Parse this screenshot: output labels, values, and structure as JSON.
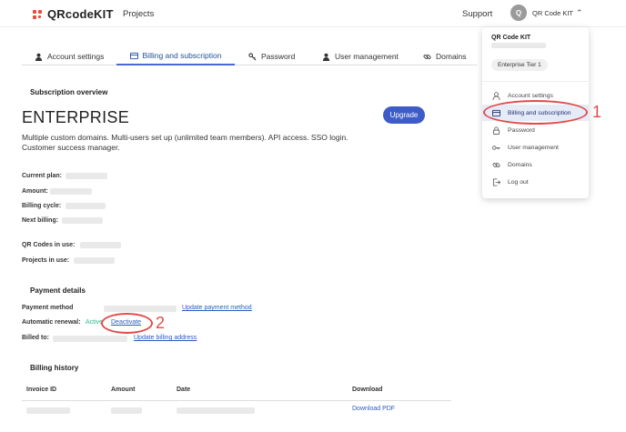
{
  "topbar": {
    "logo_text": "QRcodeKIT",
    "projects": "Projects",
    "support": "Support",
    "avatar_letter": "Q",
    "account_name": "QR Code KIT"
  },
  "tabs": [
    {
      "label": "Account settings",
      "icon": "user-icon"
    },
    {
      "label": "Billing and subscription",
      "icon": "card-icon",
      "active": true
    },
    {
      "label": "Password",
      "icon": "key-icon"
    },
    {
      "label": "User management",
      "icon": "user-icon"
    },
    {
      "label": "Domains",
      "icon": "link-icon"
    }
  ],
  "subscription": {
    "heading": "Subscription overview",
    "plan": "ENTERPRISE",
    "description": "Multiple custom domains. Multi-users set up (unlimited team members). API access. SSO login. Customer success manager.",
    "upgrade": "Upgrade",
    "fields": [
      "Current plan:",
      "Amount:",
      "Billing cycle:",
      "Next billing:"
    ],
    "usage": [
      "QR Codes in use:",
      "Projects in use:"
    ]
  },
  "payment": {
    "heading": "Payment details",
    "method_label": "Payment method",
    "update_method": "Update payment method",
    "renewal_label": "Automatic renewal:",
    "renewal_status": "Active",
    "deactivate": "Deactivate",
    "billed_label": "Billed to:",
    "update_address": "Update billing address"
  },
  "billing_history": {
    "heading": "Billing history",
    "columns": [
      "Invoice ID",
      "Amount",
      "Date",
      "Download"
    ],
    "download_pdf": "Download PDF"
  },
  "dropdown": {
    "name": "QR Code KIT",
    "tier": "Enterprise Tier 1",
    "items": [
      {
        "label": "Account settings",
        "icon": "user-icon"
      },
      {
        "label": "Billing and subscription",
        "icon": "card-icon",
        "active": true
      },
      {
        "label": "Password",
        "icon": "lock-icon"
      },
      {
        "label": "User management",
        "icon": "key-icon"
      },
      {
        "label": "Domains",
        "icon": "link-icon"
      },
      {
        "label": "Log out",
        "icon": "logout-icon"
      }
    ]
  },
  "annotations": {
    "one": "1",
    "two": "2"
  },
  "colors": {
    "accent": "#3d5cc7",
    "annotation": "#e14c4c",
    "active": "#2cb58f"
  }
}
